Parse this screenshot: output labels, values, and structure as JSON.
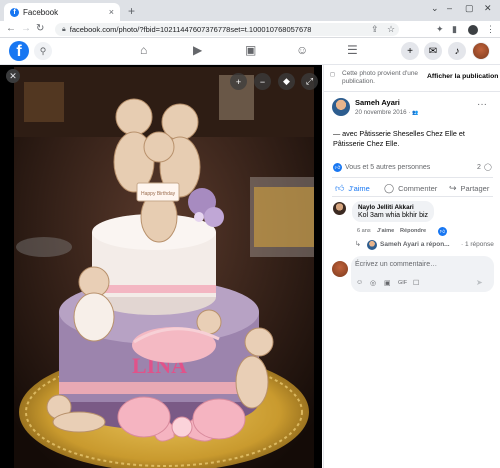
{
  "browser": {
    "tab_title": "Facebook",
    "tab_favicon": "f",
    "tab_close": "×",
    "new_tab": "+",
    "url": "facebook.com/photo/?fbid=10211447607376778set=t.100010768057678",
    "window_controls": [
      "⌄",
      "–",
      "▢",
      "✕"
    ]
  },
  "fb_header": {
    "logo": "f",
    "search_icon": "⚲",
    "nav_icons": [
      "home-icon",
      "video-icon",
      "marketplace-icon",
      "groups-icon",
      "menu-icon"
    ],
    "nav_glyphs": [
      "⌂",
      "▶",
      "▣",
      "☺",
      "☰"
    ],
    "create_glyph": "+",
    "messenger_glyph": "✉",
    "notification_glyph": "♪"
  },
  "photo": {
    "close_glyph": "✕",
    "zoom_in": "+",
    "zoom_out": "−",
    "tag": "◆",
    "fullscreen": "⤢",
    "cake_text": "LINA",
    "plaque_text": "Happy Birthday"
  },
  "sidebar": {
    "notice": "Cette photo provient d'une publication.",
    "notice_link": "Afficher la publication",
    "author": "Sameh Ayari",
    "date": "20 novembre 2016 · ",
    "date_icon": "👥",
    "more": "···",
    "caption": "— avec Pâtisserie Sheselles Chez Elle et Pâtisserie Chez Elle.",
    "reactions_text": "Vous et 5 autres personnes",
    "comment_count": "2",
    "actions": {
      "like": "J'aime",
      "comment": "Commenter",
      "share": "Partager"
    },
    "comment": {
      "name": "Naylo Jelliti Akkari",
      "text": "Kol 3am whia bkhir biz",
      "time": "6 ans",
      "like": "J'aime",
      "reply": "Répondre"
    },
    "reply_preview": {
      "author": "Sameh Ayari a répon...",
      "count": "· 1 réponse"
    },
    "composer": {
      "placeholder": "Écrivez un commentaire…",
      "tools": [
        "☺",
        "◎",
        "▣",
        "GIF",
        "☐"
      ],
      "send": "➤"
    }
  },
  "colors": {
    "fb_blue": "#1877f2",
    "bg_gray": "#f0f2f5",
    "text_secondary": "#65676b"
  }
}
